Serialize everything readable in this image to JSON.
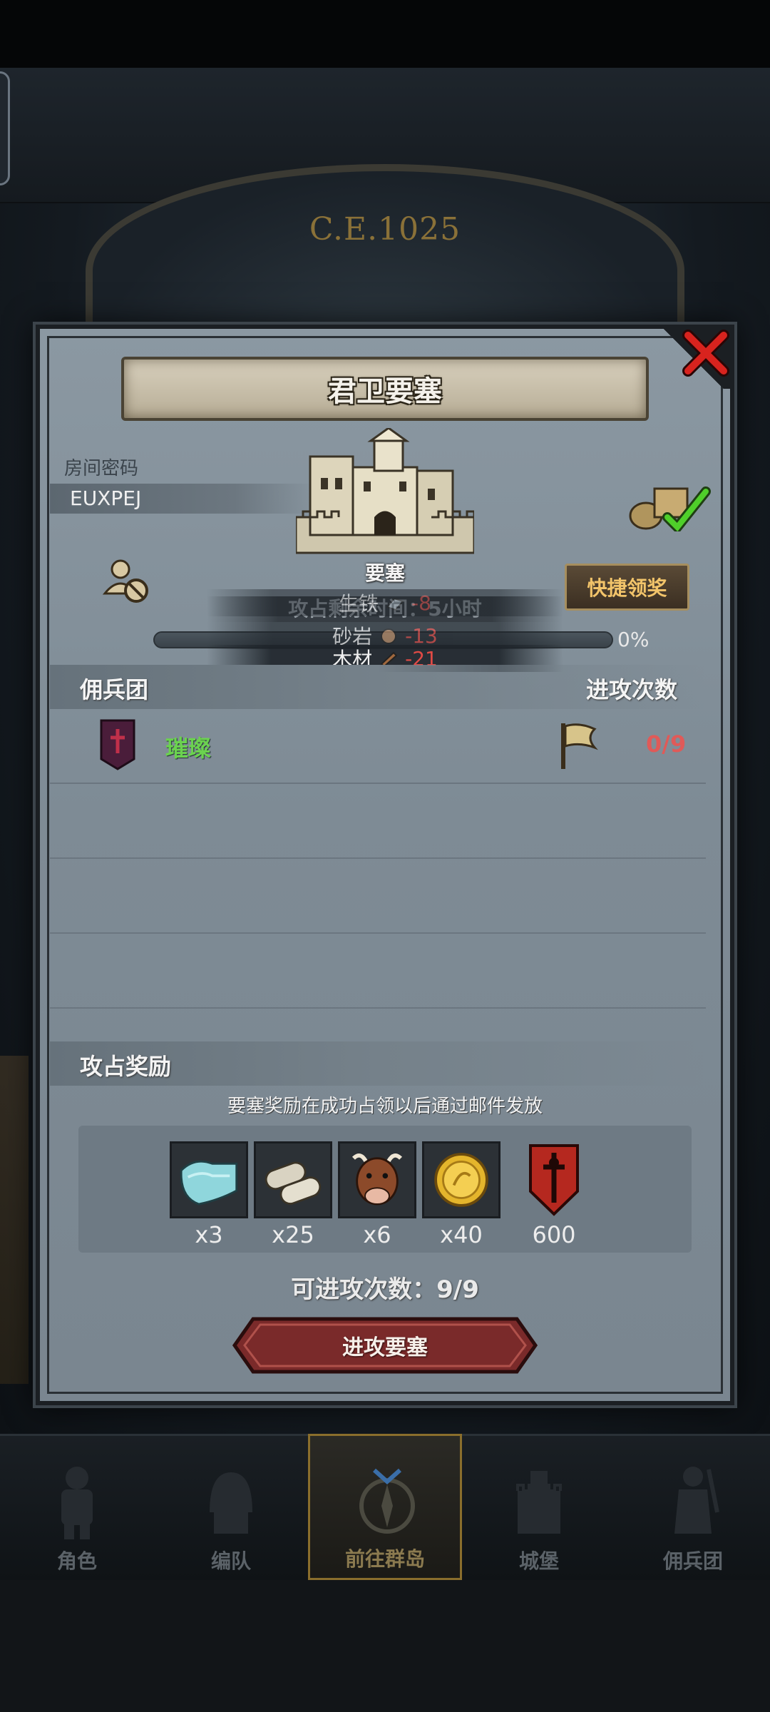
{
  "background": {
    "era": "C.E.1025"
  },
  "dialog": {
    "title": "君卫要塞",
    "room_code_label": "房间密码",
    "room_code": "EUXPEJ",
    "building_label": "要塞",
    "quick_claim": "快捷领奖",
    "occupy_time": "攻占剩余时间：5小时",
    "progress_percent": "0%",
    "progress_value": 0,
    "resources": [
      {
        "name": "生铁",
        "value": "-8"
      },
      {
        "name": "砂岩",
        "value": "-13"
      },
      {
        "name": "木材",
        "value": "-21"
      }
    ],
    "mercenary_header": "佣兵团",
    "attack_count_header": "进攻次数",
    "mercenary": {
      "name": "璀璨",
      "attack_count": "0/9"
    },
    "reward_header": "攻占奖励",
    "reward_note": "要塞奖励在成功占领以后通过邮件发放",
    "rewards": [
      {
        "icon": "cloth-icon",
        "count": "x3"
      },
      {
        "icon": "scroll-icon",
        "count": "x25"
      },
      {
        "icon": "cow-icon",
        "count": "x6"
      },
      {
        "icon": "gold-coin-icon",
        "count": "x40"
      },
      {
        "icon": "sword-emblem-icon",
        "count": "600"
      }
    ],
    "attempts": "可进攻次数：9/9",
    "attack_button": "进攻要塞"
  },
  "nav": {
    "items": [
      {
        "label": "角色",
        "icon": "knight-icon"
      },
      {
        "label": "编队",
        "icon": "helmet-icon"
      },
      {
        "label": "前往群岛",
        "icon": "compass-icon",
        "active": true
      },
      {
        "label": "城堡",
        "icon": "castle-icon"
      },
      {
        "label": "佣兵团",
        "icon": "mercenary-icon"
      }
    ]
  },
  "colors": {
    "accent_gold": "#f2c46a",
    "mercenary_green": "#6bd24f",
    "negative_red": "#e04a45",
    "button_red": "#7a2a2a"
  }
}
